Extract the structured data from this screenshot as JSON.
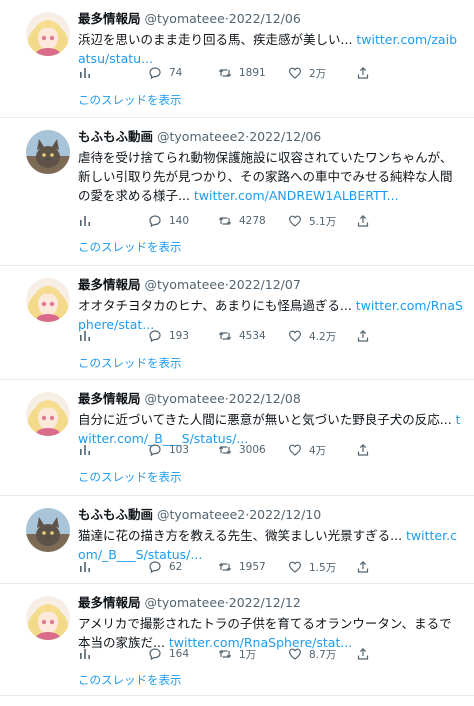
{
  "tweets": [
    {
      "account": "A",
      "name": "最多情報局",
      "handle": "@tyomateee",
      "date": "2022/12/06",
      "text": "浜辺を思いのまま走り回る馬、疾走感が美しい...",
      "link": "twitter.com/zaibatsu/statu...",
      "replies": "74",
      "retweets": "1891",
      "likes": "2万",
      "show_thread": "このスレッドを表示"
    },
    {
      "account": "B",
      "name": "もふもふ動画",
      "handle": "@tyomateee2",
      "date": "2022/12/06",
      "text": "虐待を受け捨てられ動物保護施設に収容されていたワンちゃんが、新しい引取り先が見つかり、その家路への車中でみせる純粋な人間の愛を求める様子...",
      "link": "twitter.com/ANDREW1ALBERTT...",
      "replies": "140",
      "retweets": "4278",
      "likes": "5.1万",
      "show_thread": "このスレッドを表示"
    },
    {
      "account": "A",
      "name": "最多情報局",
      "handle": "@tyomateee",
      "date": "2022/12/07",
      "text": "オオタチヨタカのヒナ、あまりにも怪鳥過ぎる...",
      "link": "twitter.com/RnaSphere/stat...",
      "replies": "193",
      "retweets": "4534",
      "likes": "4.2万",
      "show_thread": "このスレッドを表示"
    },
    {
      "account": "A",
      "name": "最多情報局",
      "handle": "@tyomateee",
      "date": "2022/12/08",
      "text": "自分に近づいてきた人間に悪意が無いと気づいた野良子犬の反応...",
      "link": "twitter.com/_B___S/status/...",
      "replies": "103",
      "retweets": "3006",
      "likes": "4万",
      "show_thread": "このスレッドを表示"
    },
    {
      "account": "B",
      "name": "もふもふ動画",
      "handle": "@tyomateee2",
      "date": "2022/12/10",
      "text": "猫達に花の描き方を教える先生、微笑ましい光景すぎる...",
      "link": "twitter.com/_B___S/status/...",
      "replies": "62",
      "retweets": "1957",
      "likes": "1.5万",
      "show_thread": "このスレッドを表示"
    },
    {
      "account": "A",
      "name": "最多情報局",
      "handle": "@tyomateee",
      "date": "2022/12/12",
      "text": "アメリカで撮影されたトラの子供を育てるオランウータン、まるで本当の家族だ...",
      "link": "twitter.com/RnaSphere/stat...",
      "replies": "164",
      "retweets": "1万",
      "likes": "8.7万",
      "show_thread": "このスレッドを表示"
    }
  ],
  "separator": "·",
  "icons": {
    "views": "bar-chart-icon",
    "reply": "reply-bubble-icon",
    "retweet": "retweet-icon",
    "like": "heart-icon",
    "share": "share-icon"
  },
  "colors": {
    "link": "#1d9bf0",
    "muted": "#536471",
    "text": "#0f1419",
    "divider": "#e6ecf0"
  }
}
